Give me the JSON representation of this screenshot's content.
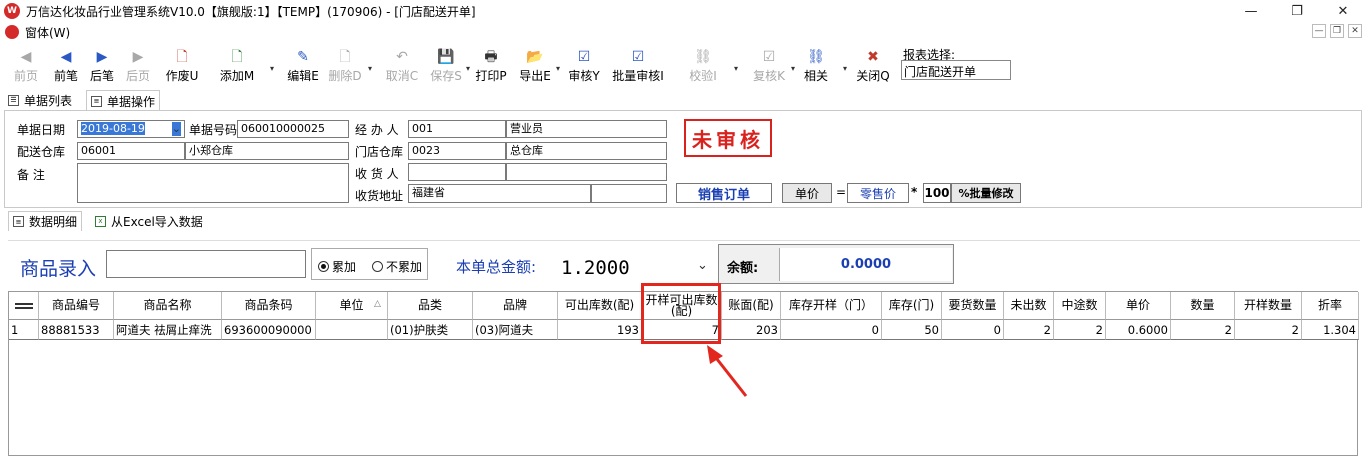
{
  "window": {
    "title": "万信达化妆品行业管理系统V10.0【旗舰版:1】【TEMP】(170906) - [门店配送开单]",
    "min_glyph": "—",
    "max_glyph": "❐",
    "close_glyph": "✕"
  },
  "menu": {
    "item": "窗体(W)"
  },
  "toolbar": {
    "buttons": [
      {
        "label": "前页",
        "icon": "prev-first-icon",
        "glyph": "◀",
        "enabled": false
      },
      {
        "label": "前笔",
        "icon": "prev-icon",
        "glyph": "◀",
        "enabled": true
      },
      {
        "label": "后笔",
        "icon": "next-icon",
        "glyph": "▶",
        "enabled": true
      },
      {
        "label": "后页",
        "icon": "next-last-icon",
        "glyph": "▶",
        "enabled": false
      },
      {
        "label": "作废U",
        "icon": "void-icon",
        "glyph": "🗋",
        "enabled": true
      },
      {
        "label": "添加M",
        "icon": "add-icon",
        "glyph": "🗋",
        "enabled": true
      },
      {
        "label": "编辑E",
        "icon": "edit-icon",
        "glyph": "✎",
        "enabled": true
      },
      {
        "label": "删除D",
        "icon": "delete-icon",
        "glyph": "🗋",
        "enabled": false
      },
      {
        "label": "取消C",
        "icon": "undo-icon",
        "glyph": "↶",
        "enabled": false
      },
      {
        "label": "保存S",
        "icon": "save-icon",
        "glyph": "💾",
        "enabled": false
      },
      {
        "label": "打印P",
        "icon": "printer-icon",
        "glyph": "🖶",
        "enabled": true
      },
      {
        "label": "导出E",
        "icon": "export-icon",
        "glyph": "📂",
        "enabled": true
      },
      {
        "label": "审核Y",
        "icon": "approve-icon",
        "glyph": "☑",
        "enabled": true
      },
      {
        "label": "批量审核I",
        "icon": "batch-approve-icon",
        "glyph": "☑",
        "enabled": true
      },
      {
        "label": "校验I",
        "icon": "verify-icon",
        "glyph": "⛓",
        "enabled": false
      },
      {
        "label": "复核K",
        "icon": "recheck-icon",
        "glyph": "☑",
        "enabled": false
      },
      {
        "label": "相关",
        "icon": "link-icon",
        "glyph": "⛓",
        "enabled": true
      },
      {
        "label": "关闭Q",
        "icon": "close-icon",
        "glyph": "✖",
        "enabled": true
      }
    ],
    "report_label": "报表选择:",
    "report_value": "门店配送开单"
  },
  "tabs_top": [
    "单据列表",
    "单据操作"
  ],
  "form": {
    "date_label": "单据日期",
    "date_value": "2019-08-19",
    "docno_label": "单据号码",
    "docno_value": "060010000025",
    "handler_label": "经 办 人",
    "handler_code": "001",
    "handler_name": "营业员",
    "dist_wh_label": "配送仓库",
    "dist_wh_code": "06001",
    "dist_wh_name": "小郑仓库",
    "store_wh_label": "门店仓库",
    "store_wh_code": "0023",
    "store_wh_name": "总仓库",
    "remark_label": "备    注",
    "receiver_label": "收 货 人",
    "address_label": "收货地址",
    "address_value": "福建省",
    "status": "未审核",
    "order_type": "销售订单",
    "price_label": "单价",
    "eq_sign": "=",
    "price_type": "零售价",
    "mult_sign": "*",
    "percent": "100",
    "batch_edit": "%批量修改"
  },
  "tabs_detail": [
    "数据明细",
    "从Excel导入数据"
  ],
  "entry": {
    "product_entry_label": "商品录入",
    "radio_accumulate": "累加",
    "radio_no_accumulate": "不累加",
    "total_label": "本单总金额:",
    "total_value": "1.2000",
    "balance_label": "余额:",
    "balance_value": "0.0000"
  },
  "grid": {
    "columns": [
      "商品编号",
      "商品名称",
      "商品条码",
      "单位",
      "品类",
      "品牌",
      "可出库数(配)",
      "开样可出库数(配)",
      "账面(配)",
      "库存开样（门）",
      "库存(门)",
      "要货数量",
      "未出数",
      "中途数",
      "单价",
      "数量",
      "开样数量",
      "折率"
    ],
    "rows": [
      [
        "1",
        "88881533",
        "阿道夫 祛屑止痒洗",
        "693600090000",
        "",
        "(01)护肤类",
        "(03)阿道夫",
        "193",
        "7",
        "203",
        "0",
        "50",
        "0",
        "2",
        "2",
        "0.6000",
        "2",
        "2",
        "1.304"
      ]
    ]
  },
  "colors": {
    "highlight": "#e2281e",
    "status_red": "#d9221e",
    "label_blue": "#1b3fb3",
    "selection_blue": "#3978d6"
  }
}
